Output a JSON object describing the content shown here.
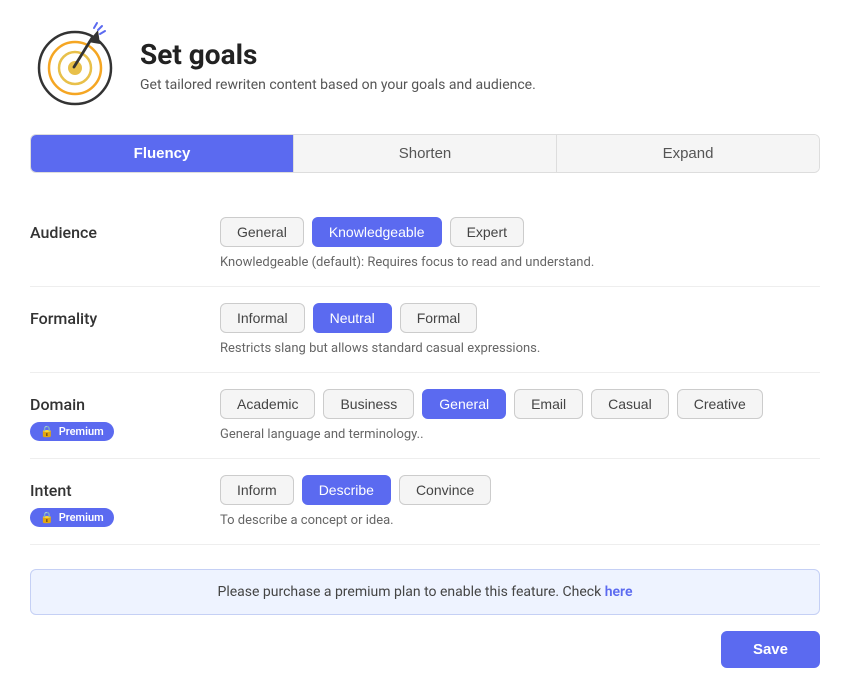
{
  "header": {
    "title": "Set goals",
    "subtitle": "Get tailored rewriten content based on your goals and audience."
  },
  "tabs": [
    {
      "id": "fluency",
      "label": "Fluency",
      "active": true
    },
    {
      "id": "shorten",
      "label": "Shorten",
      "active": false
    },
    {
      "id": "expand",
      "label": "Expand",
      "active": false
    }
  ],
  "sections": {
    "audience": {
      "label": "Audience",
      "options": [
        "General",
        "Knowledgeable",
        "Expert"
      ],
      "active": "Knowledgeable",
      "description": "Knowledgeable (default): Requires focus to read and understand."
    },
    "formality": {
      "label": "Formality",
      "options": [
        "Informal",
        "Neutral",
        "Formal"
      ],
      "active": "Neutral",
      "description": "Restricts slang but allows standard casual expressions."
    },
    "domain": {
      "label": "Domain",
      "premium_label": "Premium",
      "options": [
        "Academic",
        "Business",
        "General",
        "Email",
        "Casual",
        "Creative"
      ],
      "active": "General",
      "description": "General language and terminology.."
    },
    "intent": {
      "label": "Intent",
      "premium_label": "Premium",
      "options": [
        "Inform",
        "Describe",
        "Convince"
      ],
      "active": "Describe",
      "description": "To describe a concept or idea."
    }
  },
  "premium_notice": {
    "text": "Please purchase a premium plan to enable this feature. Check",
    "link_text": "here"
  },
  "save_button": "Save"
}
